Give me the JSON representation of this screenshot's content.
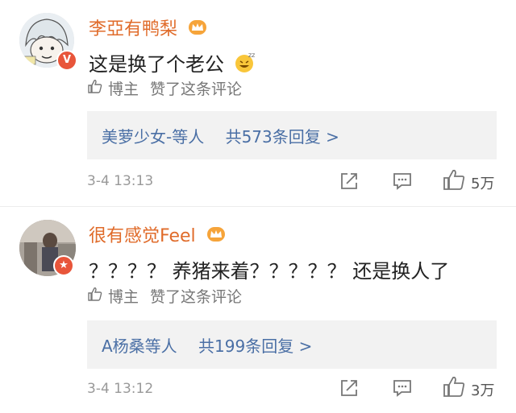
{
  "comments": [
    {
      "username": "李亞有鸭梨",
      "text": "这是换了个老公",
      "liked_by": {
        "who": "博主",
        "label": "赞了这条评论"
      },
      "replies": {
        "names": "美萝少女-等人",
        "count": "共573条回复 >"
      },
      "time": "3-4 13:13",
      "likes": "5万"
    },
    {
      "username": "很有感觉Feel",
      "text": "？？？？ 养猪来着？？？？？ 还是换人了",
      "liked_by": {
        "who": "博主",
        "label": "赞了这条评论"
      },
      "replies": {
        "names": "A杨桑等人",
        "count": "共199条回复 >"
      },
      "time": "3-4 13:12",
      "likes": "3万"
    }
  ],
  "colors": {
    "username": "#e06b2a",
    "reply_link": "#4a6fa5",
    "badge": "#e8553a"
  }
}
